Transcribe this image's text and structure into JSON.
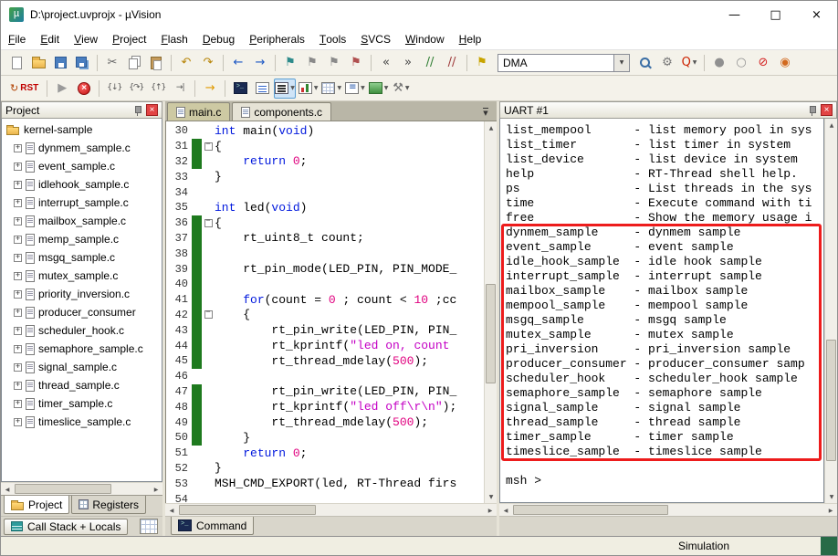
{
  "window": {
    "icon_glyph": "µ",
    "title": "D:\\project.uvprojx - µVision",
    "minimize": "—",
    "maximize": "□",
    "close": "×"
  },
  "menu": [
    "File",
    "Edit",
    "View",
    "Project",
    "Flash",
    "Debug",
    "Peripherals",
    "Tools",
    "SVCS",
    "Window",
    "Help"
  ],
  "toolbar1": {
    "combo_value": "DMA",
    "items": [
      {
        "name": "new-file-icon",
        "cls": "i-page"
      },
      {
        "name": "open-file-icon",
        "cls": "i-folder"
      },
      {
        "name": "save-icon",
        "cls": "i-floppy"
      },
      {
        "name": "save-all-icon",
        "cls": "i-floppy2"
      },
      {
        "sep": true
      },
      {
        "name": "cut-icon",
        "glyph": "✂",
        "color": "#666666"
      },
      {
        "name": "copy-icon",
        "cls": "i-copy"
      },
      {
        "name": "paste-icon",
        "cls": "i-paste"
      },
      {
        "sep": true
      },
      {
        "name": "undo-icon",
        "glyph": "↶",
        "color": "#b8860b"
      },
      {
        "name": "redo-icon",
        "glyph": "↷",
        "color": "#b8860b"
      },
      {
        "sep": true
      },
      {
        "name": "navigate-back-icon",
        "glyph": "←",
        "color": "#1a56c4"
      },
      {
        "name": "navigate-forward-icon",
        "glyph": "→",
        "color": "#1a56c4"
      },
      {
        "sep": true
      },
      {
        "name": "bookmark-toggle-icon",
        "glyph": "⚑",
        "color": "#2e8b8b"
      },
      {
        "name": "bookmark-prev-icon",
        "glyph": "⚑",
        "color": "#8a8a8a"
      },
      {
        "name": "bookmark-next-icon",
        "glyph": "⚑",
        "color": "#8a8a8a"
      },
      {
        "name": "bookmark-clear-icon",
        "glyph": "⚑",
        "color": "#b05050"
      },
      {
        "sep": true
      },
      {
        "name": "unindent-icon",
        "glyph": "«",
        "color": "#444444"
      },
      {
        "name": "indent-icon",
        "glyph": "»",
        "color": "#444444"
      },
      {
        "name": "comment-icon",
        "glyph": "//",
        "color": "#2e7d32"
      },
      {
        "name": "uncomment-icon",
        "glyph": "//",
        "color": "#9e3a3a"
      },
      {
        "sep": true
      },
      {
        "name": "target-flag-icon",
        "glyph": "⚑",
        "color": "#c8a400"
      },
      {
        "combo": true
      },
      {
        "name": "manage-target-icon",
        "cls": "i-mag"
      },
      {
        "name": "configure-flash-icon",
        "glyph": "⚙",
        "color": "#777777"
      },
      {
        "name": "debug-session-icon",
        "glyph": "Q",
        "color": "#cc2200",
        "dd": true
      },
      {
        "sep": true
      },
      {
        "name": "breakpoint-icon",
        "glyph": "●",
        "color": "#909090"
      },
      {
        "name": "breakpoint-enable-icon",
        "glyph": "○",
        "color": "#909090"
      },
      {
        "name": "breakpoint-kill-icon",
        "glyph": "⊘",
        "color": "#d42222"
      },
      {
        "name": "breakpoint-disable-icon",
        "glyph": "◉",
        "color": "#d2691e"
      }
    ]
  },
  "toolbar2": {
    "rst_label": "RST",
    "items": [
      {
        "rst": true
      },
      {
        "sep": true
      },
      {
        "name": "run-icon",
        "glyph": "▶",
        "color": "#9a9a9a"
      },
      {
        "name": "stop-icon",
        "cls": "i-stop"
      },
      {
        "sep": true
      },
      {
        "name": "step-into-icon",
        "glyph": "{↓}",
        "color": "#555555",
        "small": true
      },
      {
        "name": "step-over-icon",
        "glyph": "{↷}",
        "color": "#555555",
        "small": true
      },
      {
        "name": "step-out-icon",
        "glyph": "{↑}",
        "color": "#555555",
        "small": true
      },
      {
        "name": "run-to-cursor-icon",
        "glyph": "→|",
        "color": "#555555",
        "small": true
      },
      {
        "sep": true
      },
      {
        "name": "show-next-statement-icon",
        "glyph": "→",
        "color": "#e09a00"
      },
      {
        "sep": true
      },
      {
        "name": "command-window-icon",
        "cls": "i-term"
      },
      {
        "name": "disassembly-window-icon",
        "cls": "i-asm"
      },
      {
        "name": "serial-window-button",
        "cls": "i-serial",
        "dd": true,
        "selected": true
      },
      {
        "name": "analysis-windows-icon",
        "cls": "i-chart",
        "dd": true
      },
      {
        "name": "memory-window-icon",
        "cls": "i-mem",
        "dd": true
      },
      {
        "name": "watch-window-icon",
        "cls": "i-watch",
        "dd": true
      },
      {
        "name": "system-viewer-icon",
        "cls": "i-sys",
        "dd": true
      },
      {
        "name": "toolbox-icon",
        "glyph": "⚒",
        "color": "#777777",
        "dd": true
      }
    ]
  },
  "project": {
    "header": "Project",
    "root": "kernel-sample",
    "files": [
      "dynmem_sample.c",
      "event_sample.c",
      "idlehook_sample.c",
      "interrupt_sample.c",
      "mailbox_sample.c",
      "memp_sample.c",
      "msgq_sample.c",
      "mutex_sample.c",
      "priority_inversion.c",
      "producer_consumer",
      "scheduler_hook.c",
      "semaphore_sample.c",
      "signal_sample.c",
      "thread_sample.c",
      "timer_sample.c",
      "timeslice_sample.c"
    ]
  },
  "editor": {
    "tabs": [
      {
        "label": "main.c",
        "active": true
      },
      {
        "label": "components.c",
        "active": false
      }
    ],
    "lines": [
      {
        "n": 30,
        "t": [
          [
            "k",
            "int"
          ],
          [
            "p",
            " main("
          ],
          [
            "k",
            "void"
          ],
          [
            "p",
            ")"
          ]
        ]
      },
      {
        "n": 31,
        "chg": true,
        "fold": true,
        "t": [
          [
            "p",
            "{"
          ]
        ]
      },
      {
        "n": 32,
        "chg": true,
        "t": [
          [
            "p",
            "    "
          ],
          [
            "k",
            "return"
          ],
          [
            "p",
            " "
          ],
          [
            "n",
            "0"
          ],
          [
            "p",
            ";"
          ]
        ]
      },
      {
        "n": 33,
        "t": [
          [
            "p",
            "}"
          ]
        ]
      },
      {
        "n": 34,
        "t": []
      },
      {
        "n": 35,
        "t": [
          [
            "k",
            "int"
          ],
          [
            "p",
            " led("
          ],
          [
            "k",
            "void"
          ],
          [
            "p",
            ")"
          ]
        ]
      },
      {
        "n": 36,
        "chg": true,
        "fold": true,
        "t": [
          [
            "p",
            "{"
          ]
        ]
      },
      {
        "n": 37,
        "chg": true,
        "t": [
          [
            "p",
            "    rt_uint8_t count;"
          ]
        ]
      },
      {
        "n": 38,
        "chg": true,
        "t": []
      },
      {
        "n": 39,
        "chg": true,
        "t": [
          [
            "p",
            "    rt_pin_mode(LED_PIN, PIN_MODE_"
          ]
        ]
      },
      {
        "n": 40,
        "chg": true,
        "t": []
      },
      {
        "n": 41,
        "chg": true,
        "t": [
          [
            "p",
            "    "
          ],
          [
            "k",
            "for"
          ],
          [
            "p",
            "(count = "
          ],
          [
            "n",
            "0"
          ],
          [
            "p",
            " ; count < "
          ],
          [
            "n",
            "10"
          ],
          [
            "p",
            " ;cc"
          ]
        ]
      },
      {
        "n": 42,
        "chg": true,
        "fold": true,
        "t": [
          [
            "p",
            "    {"
          ]
        ]
      },
      {
        "n": 43,
        "chg": true,
        "t": [
          [
            "p",
            "        rt_pin_write(LED_PIN, PIN_"
          ]
        ]
      },
      {
        "n": 44,
        "chg": true,
        "t": [
          [
            "p",
            "        rt_kprintf("
          ],
          [
            "s",
            "\"led on, count"
          ]
        ]
      },
      {
        "n": 45,
        "chg": true,
        "t": [
          [
            "p",
            "        rt_thread_mdelay("
          ],
          [
            "n",
            "500"
          ],
          [
            "p",
            ");"
          ]
        ]
      },
      {
        "n": 46,
        "t": []
      },
      {
        "n": 47,
        "chg": true,
        "t": [
          [
            "p",
            "        rt_pin_write(LED_PIN, PIN_"
          ]
        ]
      },
      {
        "n": 48,
        "chg": true,
        "t": [
          [
            "p",
            "        rt_kprintf("
          ],
          [
            "s",
            "\"led off\\r\\n\""
          ],
          [
            "p",
            ");"
          ]
        ]
      },
      {
        "n": 49,
        "chg": true,
        "t": [
          [
            "p",
            "        rt_thread_mdelay("
          ],
          [
            "n",
            "500"
          ],
          [
            "p",
            ");"
          ]
        ]
      },
      {
        "n": 50,
        "chg": true,
        "t": [
          [
            "p",
            "    }"
          ]
        ]
      },
      {
        "n": 51,
        "t": [
          [
            "p",
            "    "
          ],
          [
            "k",
            "return"
          ],
          [
            "p",
            " "
          ],
          [
            "n",
            "0"
          ],
          [
            "p",
            ";"
          ]
        ]
      },
      {
        "n": 52,
        "t": [
          [
            "p",
            "}"
          ]
        ]
      },
      {
        "n": 53,
        "t": [
          [
            "p",
            "MSH_CMD_EXPORT(led, RT-Thread firs"
          ]
        ]
      },
      {
        "n": 54,
        "t": []
      }
    ]
  },
  "uart": {
    "header": "UART #1",
    "lines": [
      "list_mempool      - list memory pool in sys",
      "list_timer        - list timer in system",
      "list_device       - list device in system",
      "help              - RT-Thread shell help.",
      "ps                - List threads in the sys",
      "time              - Execute command with ti",
      "free              - Show the memory usage i",
      "dynmem_sample     - dynmem sample",
      "event_sample      - event sample",
      "idle_hook_sample  - idle hook sample",
      "interrupt_sample  - interrupt sample",
      "mailbox_sample    - mailbox sample",
      "mempool_sample    - mempool sample",
      "msgq_sample       - msgq sample",
      "mutex_sample      - mutex sample",
      "pri_inversion     - pri_inversion sample",
      "producer_consumer - producer_consumer samp",
      "scheduler_hook    - scheduler_hook sample",
      "semaphore_sample  - semaphore sample",
      "signal_sample     - signal sample",
      "thread_sample     - thread sample",
      "timer_sample      - timer sample",
      "timeslice_sample  - timeslice sample",
      "",
      "msh >"
    ],
    "highlight_start": 7,
    "highlight_end": 22
  },
  "panels": {
    "left_tabs": [
      {
        "label": "Project",
        "active": true
      },
      {
        "label": "Registers",
        "active": false
      }
    ],
    "callstack_label": "Call Stack + Locals",
    "command_label": "Command"
  },
  "statusbar": {
    "mode": "Simulation"
  }
}
